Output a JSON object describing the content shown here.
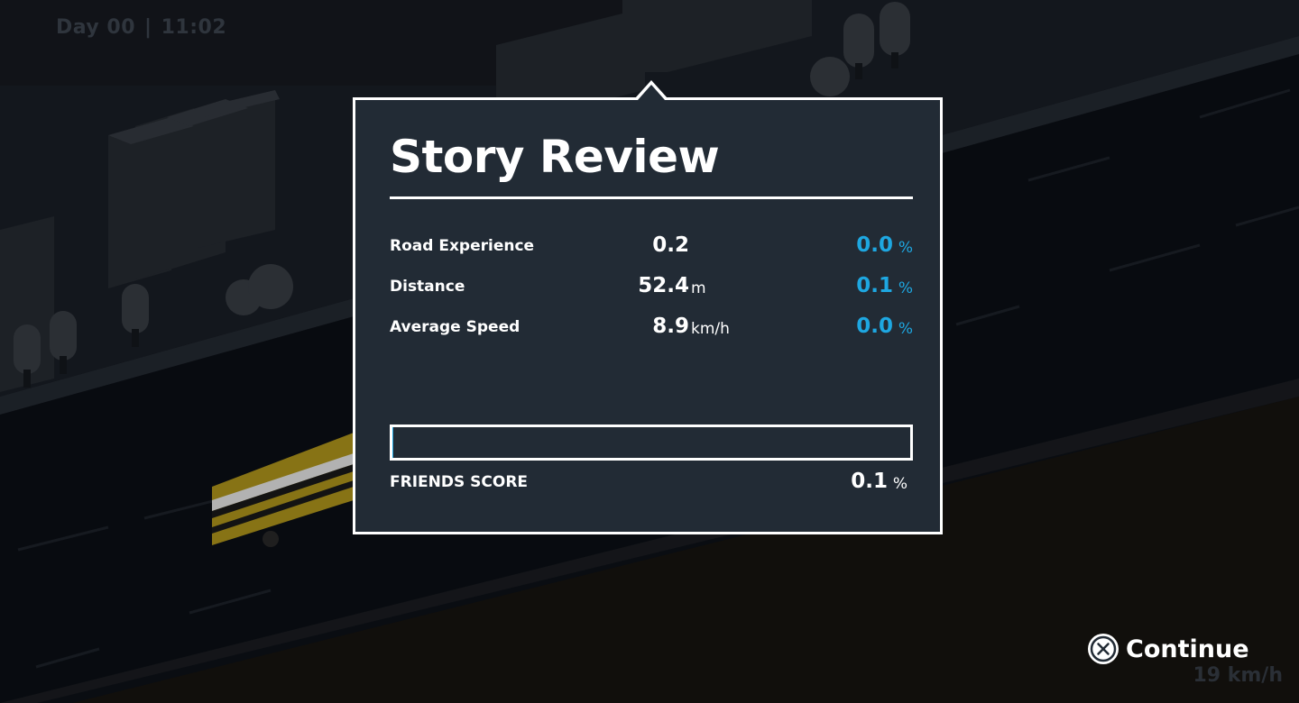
{
  "hud": {
    "day": "Day 00",
    "time": "11:02",
    "speed": "19 km/h"
  },
  "review": {
    "title": "Story Review",
    "stats": [
      {
        "label": "Road Experience",
        "value": "0.2",
        "unit": "",
        "percent": "0.0",
        "percent_sign": "%"
      },
      {
        "label": "Distance",
        "value": "52.4",
        "unit": "m",
        "percent": "0.1",
        "percent_sign": "%"
      },
      {
        "label": "Average Speed",
        "value": "8.9",
        "unit": "km/h",
        "percent": "0.0",
        "percent_sign": "%"
      }
    ],
    "friends_score": {
      "label": "FRIENDS SCORE",
      "value": "0.1",
      "percent_sign": "%",
      "progress_fraction": 0.001
    }
  },
  "continue_button": {
    "label": "Continue",
    "icon": "cross-button-icon"
  },
  "colors": {
    "accent": "#1ea7e1",
    "panel_bg": "#222b35",
    "panel_border": "#ffffff",
    "scene_bg": "#0d1118",
    "bus": "#b59a1c"
  }
}
